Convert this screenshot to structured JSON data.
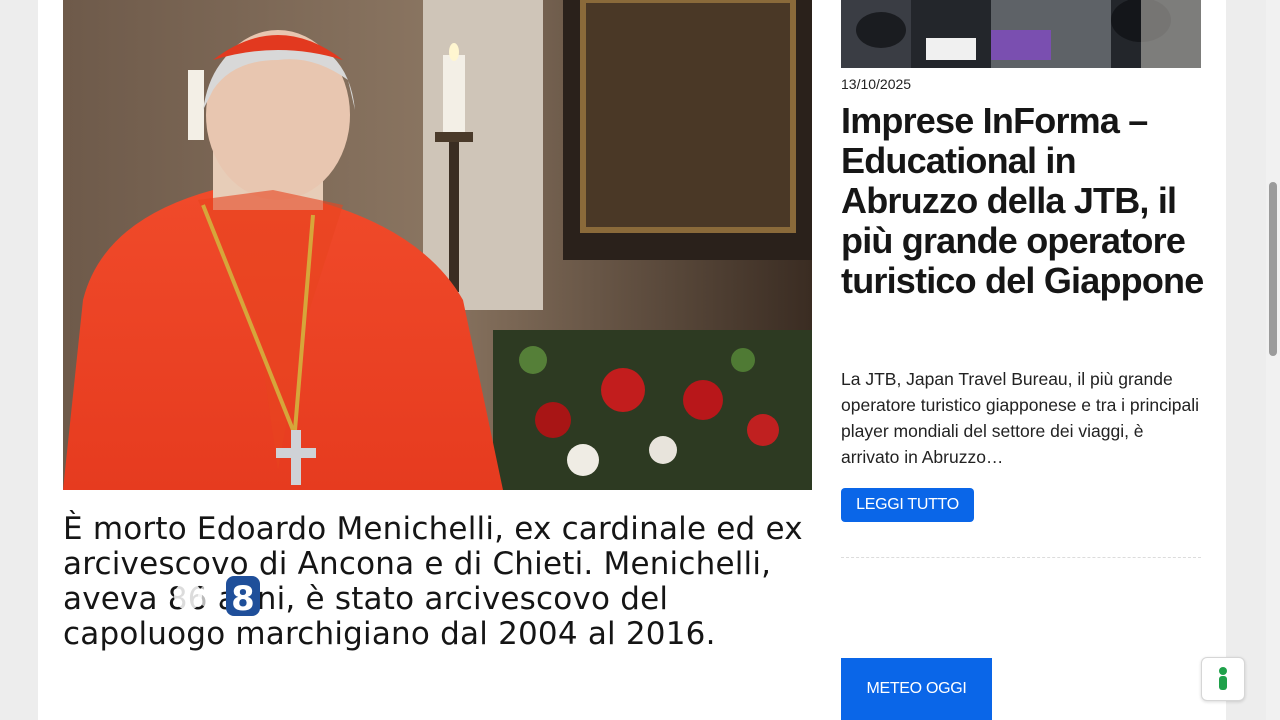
{
  "main_article": {
    "headline": "È morto Edoardo Menichelli, ex cardinale ed ex arcivescovo di Ancona e di Chieti. Menichelli, aveva 86 anni, è stato arcivescovo del capoluogo marchigiano dal 2004 al 2016.",
    "image_icon": "cardinal-portrait-photo",
    "logo_overlay_text": "8"
  },
  "side_article": {
    "date": "13/10/2025",
    "title": "Imprese InForma – Educational in Abruzzo della JTB, il più grande operatore turistico del Giappone",
    "excerpt": "La JTB, Japan Travel Bureau, il più grande operatore turistico giapponese e tra i principali player mondiali del settore dei viaggi, è arrivato in Abruzzo…",
    "read_more_label": "LEGGI TUTTO"
  },
  "widgets": {
    "meteo_label": "METEO OGGI"
  },
  "colors": {
    "accent": "#0a66e8",
    "privacy_icon": "#1fa14a"
  }
}
